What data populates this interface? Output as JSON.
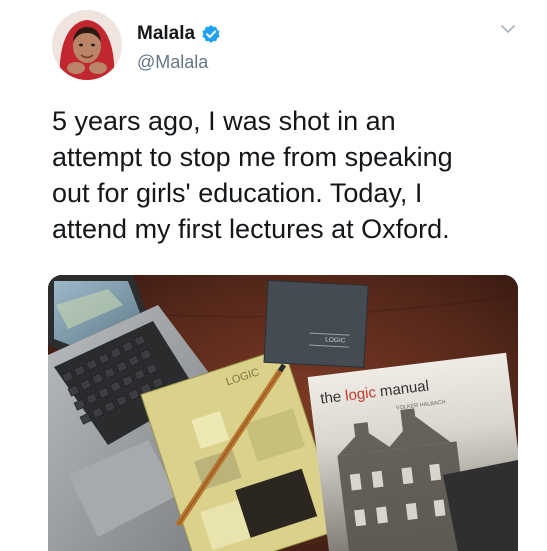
{
  "author": {
    "display_name": "Malala",
    "handle": "@Malala",
    "verified": true
  },
  "tweet": {
    "text": "5 years ago, I was shot in an\nattempt to stop me from speaking\nout for girls' education. Today, I\nattend my first lectures at Oxford."
  },
  "photo": {
    "book_left_title": "LOGIC",
    "book_middle_title": "LOGIC",
    "book_right_title_part1": "the ",
    "book_right_title_part2": "logic",
    "book_right_title_part3": " manual",
    "book_right_author": "VOLKER HALBACH"
  },
  "colors": {
    "verified_blue": "#1da1f2",
    "text_primary": "#14171a",
    "text_secondary": "#657786",
    "logic_red": "#c0392b"
  },
  "icons": {
    "verified": "verified-badge-icon",
    "menu": "chevron-down-icon"
  }
}
